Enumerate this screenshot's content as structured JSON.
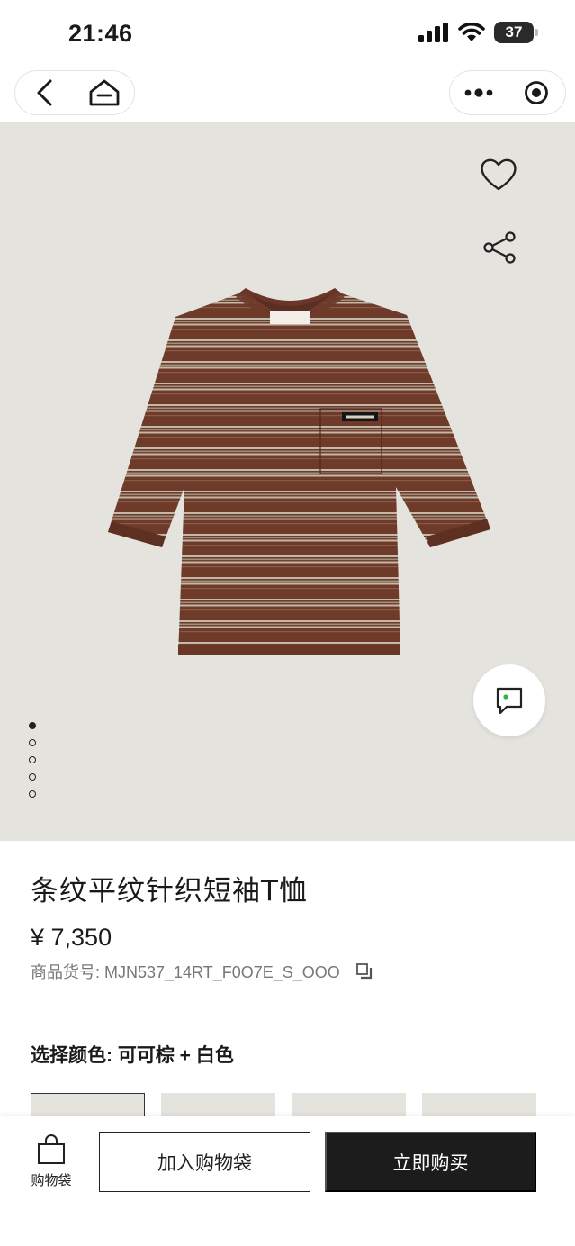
{
  "status_bar": {
    "time": "21:46",
    "battery": "37",
    "icons": [
      "signal-icon",
      "wifi-icon",
      "battery-icon"
    ]
  },
  "nav": {
    "icons": [
      "back-icon",
      "home-icon",
      "more-icon",
      "target-icon"
    ]
  },
  "gallery": {
    "image": "striped-tshirt-product-photo",
    "label_brand": "miu miu",
    "image_count": 5,
    "active_index": 0,
    "actions": [
      "heart-icon",
      "share-icon",
      "chat-icon"
    ]
  },
  "product": {
    "title": "条纹平纹针织短袖T恤",
    "price": "¥ 7,350",
    "sku": "商品货号: MJN537_14RT_F0O7E_S_OOO",
    "color_selection": "选择颜色: 可可棕 + 白色"
  },
  "bottom_bar": {
    "bag_label": "购物袋",
    "add_to_bag": "加入购物袋",
    "buy_now": "立即购买"
  },
  "colors": {
    "background": "#e5e3dd",
    "shirt_brown": "#6e3a2a",
    "stripe_light": "#b9ad9c",
    "button_dark": "#1c1c1c"
  }
}
